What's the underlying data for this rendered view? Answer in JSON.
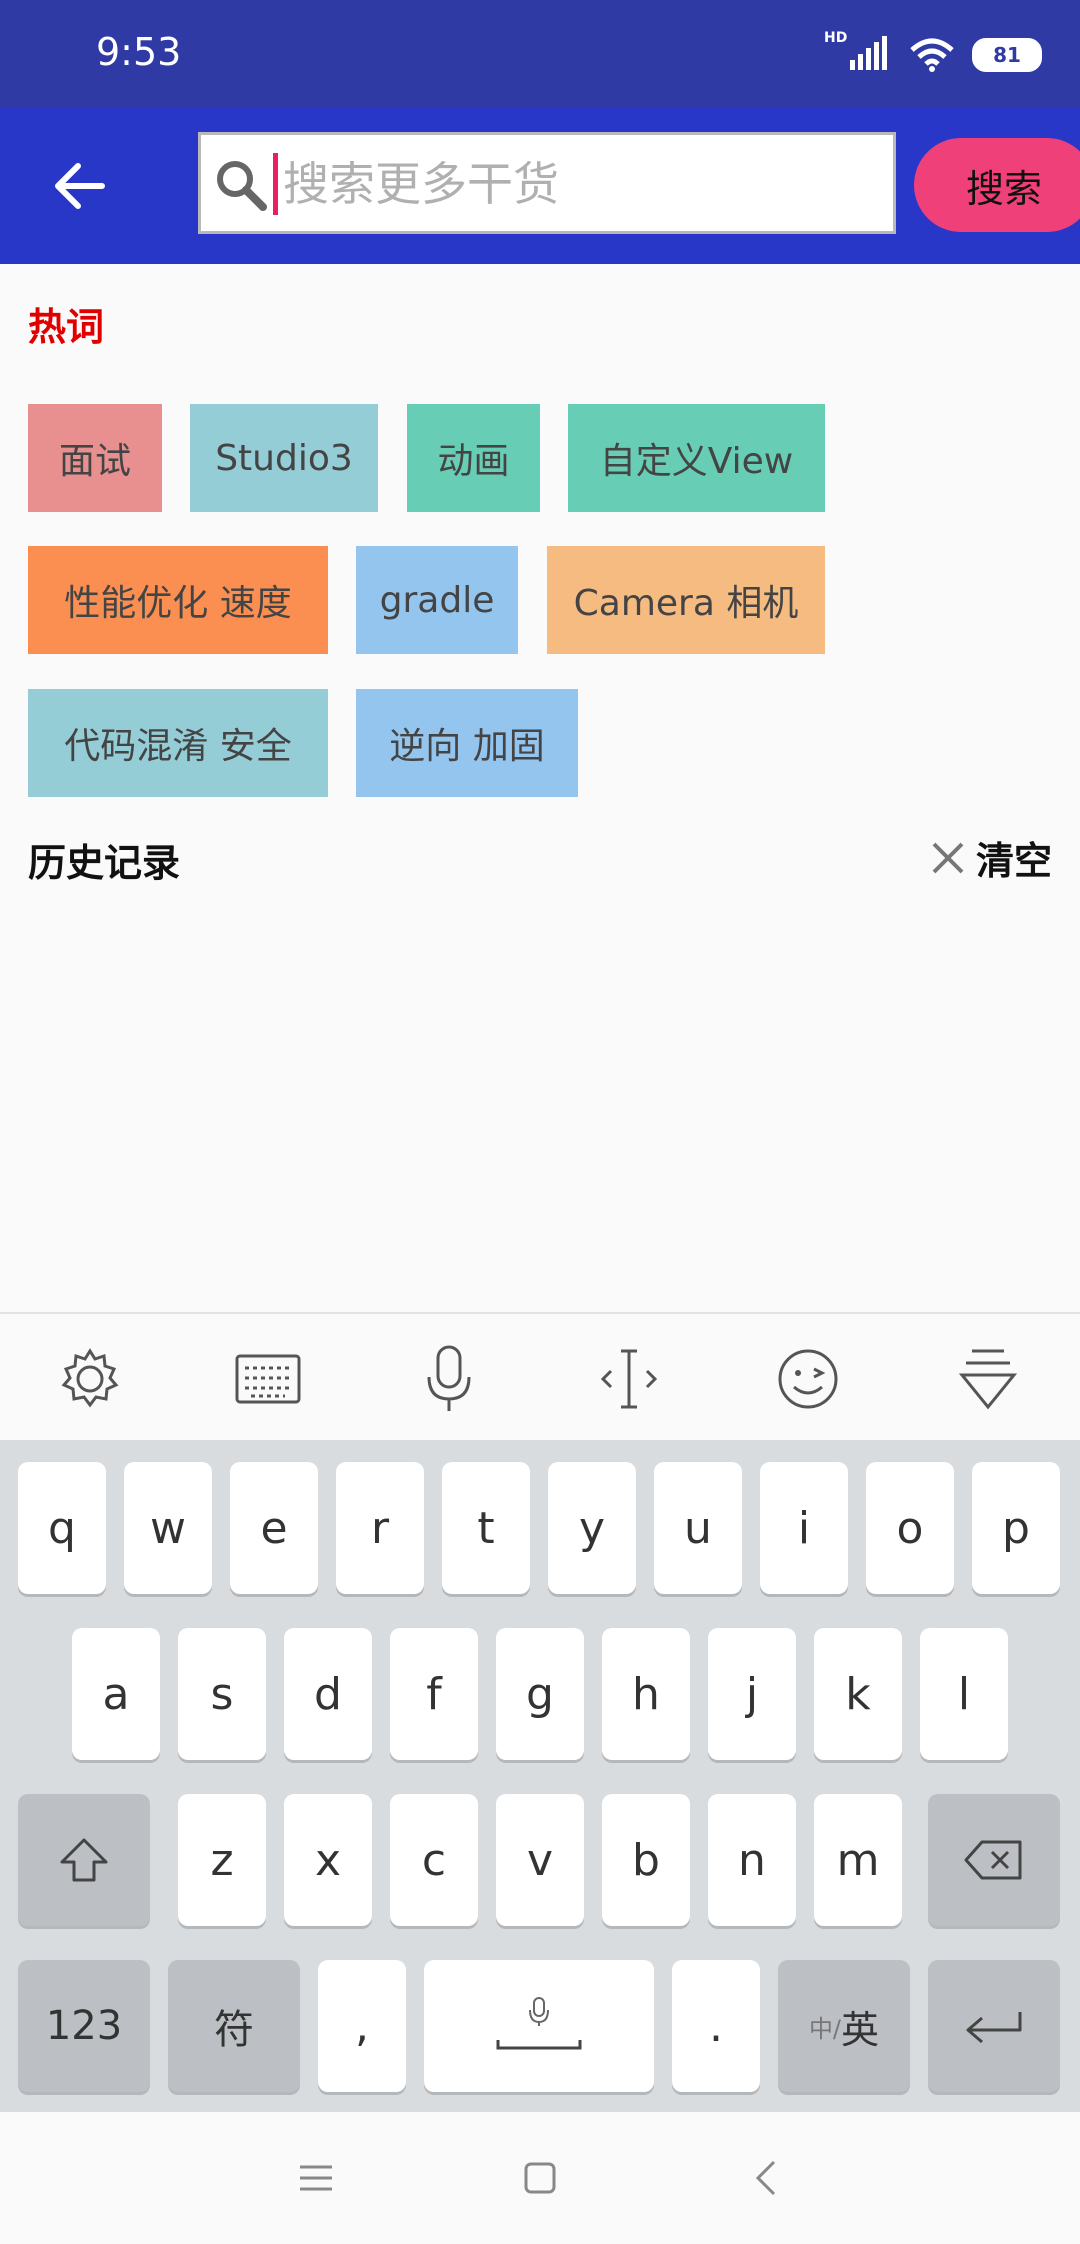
{
  "status": {
    "time": "9:53",
    "hd": "HD",
    "battery": "81"
  },
  "search": {
    "placeholder": "搜索更多干货",
    "value": "",
    "button_label": "搜索"
  },
  "hot": {
    "title": "热词",
    "tags": [
      {
        "label": "面试",
        "color": "#e89090"
      },
      {
        "label": "Studio3",
        "color": "#95cdd6"
      },
      {
        "label": "动画",
        "color": "#68cdb5"
      },
      {
        "label": "自定义View",
        "color": "#68cdb5"
      },
      {
        "label": "性能优化 速度",
        "color": "#fb8f52"
      },
      {
        "label": "gradle",
        "color": "#94c5ef"
      },
      {
        "label": "Camera 相机",
        "color": "#f5bb80"
      },
      {
        "label": "代码混淆 安全",
        "color": "#95cdd6"
      },
      {
        "label": "逆向 加固",
        "color": "#94c5ef"
      }
    ]
  },
  "history": {
    "title": "历史记录",
    "clear_label": "清空"
  },
  "keyboard": {
    "row1": [
      "q",
      "w",
      "e",
      "r",
      "t",
      "y",
      "u",
      "i",
      "o",
      "p"
    ],
    "row2": [
      "a",
      "s",
      "d",
      "f",
      "g",
      "h",
      "j",
      "k",
      "l"
    ],
    "row3": [
      "z",
      "x",
      "c",
      "v",
      "b",
      "n",
      "m"
    ],
    "num_label": "123",
    "symbol_label": "符",
    "comma": ",",
    "period": ".",
    "lang_small": "中/",
    "lang_main": "英"
  },
  "colors": {
    "status_bar": "#2f3aa5",
    "app_bar": "#2837c8",
    "accent": "#f0407a",
    "hot_title": "#e00000"
  }
}
